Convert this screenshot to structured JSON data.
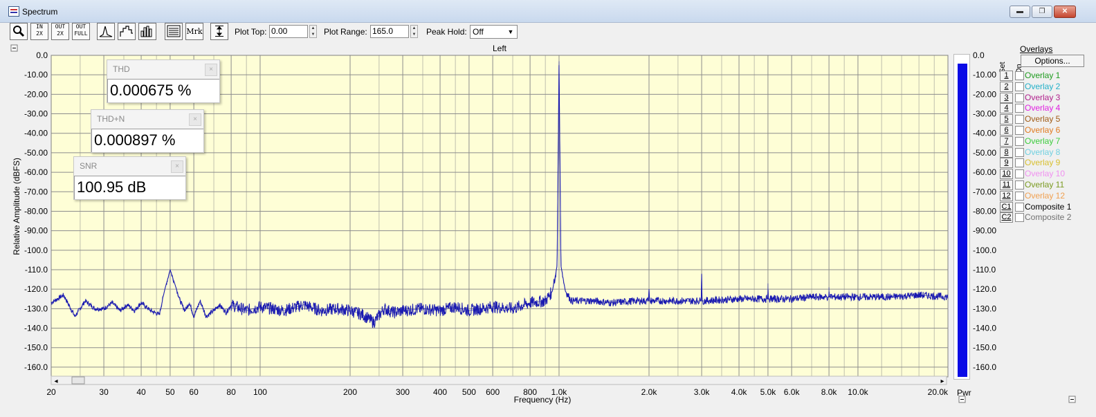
{
  "window": {
    "title": "Spectrum",
    "controls": {
      "minimize": "▬",
      "maximize": "❐",
      "close": "✕"
    }
  },
  "toolbar": {
    "buttons": [
      {
        "name": "zoom-button",
        "text": ""
      },
      {
        "name": "zoom-in-2x-button",
        "text": "IN 2X"
      },
      {
        "name": "zoom-out-2x-button",
        "text": "OUT 2X"
      },
      {
        "name": "zoom-out-full-button",
        "text": "OUT FULL"
      },
      {
        "name": "line-mode-button",
        "text": ""
      },
      {
        "name": "step-mode-button",
        "text": ""
      },
      {
        "name": "bar-mode-button",
        "text": ""
      },
      {
        "name": "table-button",
        "text": ""
      },
      {
        "name": "marker-button",
        "text": "Mrk"
      },
      {
        "name": "autoscale-button",
        "text": ""
      }
    ],
    "plot_top_label": "Plot Top:",
    "plot_top_value": "0.00",
    "plot_range_label": "Plot Range:",
    "plot_range_value": "165.0",
    "peak_hold_label": "Peak Hold:",
    "peak_hold_value": "Off"
  },
  "colors": {
    "plot_bg": "#fefed6",
    "grid": "#8c8c8c",
    "trace": "#1a1ab0",
    "pwr_bar": "#0b0be6"
  },
  "meters": {
    "thd": {
      "label": "THD",
      "value": "0.000675 %"
    },
    "thdn": {
      "label": "THD+N",
      "value": "0.000897 %"
    },
    "snr": {
      "label": "SNR",
      "value": "100.95 dB"
    }
  },
  "pwr": {
    "label": "Pwr",
    "level_dbfs": -4.0
  },
  "overlays": {
    "title": "Overlays",
    "options_label": "Options...",
    "set_header": "Set",
    "on_header": "On",
    "items": [
      {
        "set": "1",
        "name": "Overlay 1",
        "color": "#1e9b1e"
      },
      {
        "set": "2",
        "name": "Overlay 2",
        "color": "#22b0c8"
      },
      {
        "set": "3",
        "name": "Overlay 3",
        "color": "#b0208c"
      },
      {
        "set": "4",
        "name": "Overlay 4",
        "color": "#e020e0"
      },
      {
        "set": "5",
        "name": "Overlay 5",
        "color": "#a05a14"
      },
      {
        "set": "6",
        "name": "Overlay 6",
        "color": "#e07a20"
      },
      {
        "set": "7",
        "name": "Overlay 7",
        "color": "#3ccc3c"
      },
      {
        "set": "8",
        "name": "Overlay 8",
        "color": "#70d0e0"
      },
      {
        "set": "9",
        "name": "Overlay 9",
        "color": "#d8c030"
      },
      {
        "set": "10",
        "name": "Overlay 10",
        "color": "#f090f0"
      },
      {
        "set": "11",
        "name": "Overlay 11",
        "color": "#7a9a20"
      },
      {
        "set": "12",
        "name": "Overlay 12",
        "color": "#f0a050"
      },
      {
        "set": "C1",
        "name": "Composite 1",
        "color": "#000000"
      },
      {
        "set": "C2",
        "name": "Composite 2",
        "color": "#707070"
      }
    ]
  },
  "chart_data": {
    "type": "line",
    "title": "Left",
    "xlabel": "Frequency (Hz)",
    "ylabel": "Relative Amplitude (dBFS)",
    "xscale": "log",
    "xlim": [
      20,
      20000
    ],
    "ylim": [
      -165,
      0
    ],
    "grid": true,
    "x_ticks": [
      20,
      30,
      40,
      50,
      60,
      80,
      100,
      200,
      300,
      400,
      500,
      600,
      800,
      1000,
      2000,
      3000,
      4000,
      5000,
      6000,
      8000,
      10000,
      20000
    ],
    "x_tick_labels": [
      "20",
      "30",
      "40",
      "50",
      "60",
      "80",
      "100",
      "200",
      "300",
      "400",
      "500",
      "600",
      "800",
      "1.0k",
      "2.0k",
      "3.0k",
      "4.0k",
      "5.0k",
      "6.0k",
      "8.0k",
      "10.0k",
      "20.0k"
    ],
    "y_ticks": [
      0,
      -10,
      -20,
      -30,
      -40,
      -50,
      -60,
      -70,
      -80,
      -90,
      -100,
      -110,
      -120,
      -130,
      -140,
      -150,
      -160
    ],
    "y_tick_labels": [
      "0.0",
      "-10.00",
      "-20.00",
      "-30.00",
      "-40.00",
      "-50.00",
      "-60.00",
      "-70.00",
      "-80.00",
      "-90.00",
      "-100.0",
      "-110.0",
      "-120.0",
      "-130.0",
      "-140.0",
      "-150.0",
      "-160.0"
    ],
    "pwr_tick_labels": [
      "0.0",
      "-10.00",
      "-20.00",
      "-30.00",
      "-40.00",
      "-50.00",
      "-60.00",
      "-70.00",
      "-80.00",
      "-90.00",
      "-100.0",
      "-110.0",
      "-120.0",
      "-130.0",
      "-140.0",
      "-150.0",
      "-160.0"
    ],
    "series": [
      {
        "values": [
          [
            20,
            -127
          ],
          [
            22,
            -123
          ],
          [
            24,
            -134
          ],
          [
            26,
            -126
          ],
          [
            28,
            -130
          ],
          [
            30,
            -130
          ],
          [
            32,
            -127
          ],
          [
            34,
            -131
          ],
          [
            36,
            -128
          ],
          [
            38,
            -131
          ],
          [
            40,
            -127
          ],
          [
            43,
            -131
          ],
          [
            46,
            -133
          ],
          [
            48,
            -120
          ],
          [
            50,
            -110
          ],
          [
            52,
            -118
          ],
          [
            54,
            -126
          ],
          [
            56,
            -131
          ],
          [
            58,
            -127
          ],
          [
            60,
            -134
          ],
          [
            63,
            -126
          ],
          [
            66,
            -134
          ],
          [
            70,
            -131
          ],
          [
            73,
            -128
          ],
          [
            77,
            -132
          ],
          [
            80,
            -128
          ],
          [
            90,
            -131
          ],
          [
            100,
            -129
          ],
          [
            120,
            -131
          ],
          [
            140,
            -128
          ],
          [
            160,
            -131
          ],
          [
            180,
            -130
          ],
          [
            200,
            -131
          ],
          [
            220,
            -133
          ],
          [
            240,
            -137
          ],
          [
            260,
            -130
          ],
          [
            280,
            -132
          ],
          [
            300,
            -131
          ],
          [
            350,
            -130
          ],
          [
            400,
            -131
          ],
          [
            450,
            -129
          ],
          [
            500,
            -131
          ],
          [
            600,
            -129
          ],
          [
            700,
            -130
          ],
          [
            800,
            -127
          ],
          [
            900,
            -126
          ],
          [
            950,
            -121
          ],
          [
            985,
            -108
          ],
          [
            1000,
            -3
          ],
          [
            1015,
            -108
          ],
          [
            1050,
            -121
          ],
          [
            1100,
            -126
          ],
          [
            1300,
            -126
          ],
          [
            1500,
            -127
          ],
          [
            1800,
            -126
          ],
          [
            1990,
            -126
          ],
          [
            2000,
            -120
          ],
          [
            2010,
            -126
          ],
          [
            2500,
            -126
          ],
          [
            2990,
            -126
          ],
          [
            3000,
            -112
          ],
          [
            3010,
            -126
          ],
          [
            4000,
            -125
          ],
          [
            4990,
            -125
          ],
          [
            5000,
            -117
          ],
          [
            5010,
            -125
          ],
          [
            6000,
            -125
          ],
          [
            7000,
            -124
          ],
          [
            7990,
            -124
          ],
          [
            8000,
            -119
          ],
          [
            8010,
            -124
          ],
          [
            10000,
            -124
          ],
          [
            13000,
            -124
          ],
          [
            16000,
            -123
          ],
          [
            20000,
            -124
          ]
        ]
      }
    ]
  }
}
